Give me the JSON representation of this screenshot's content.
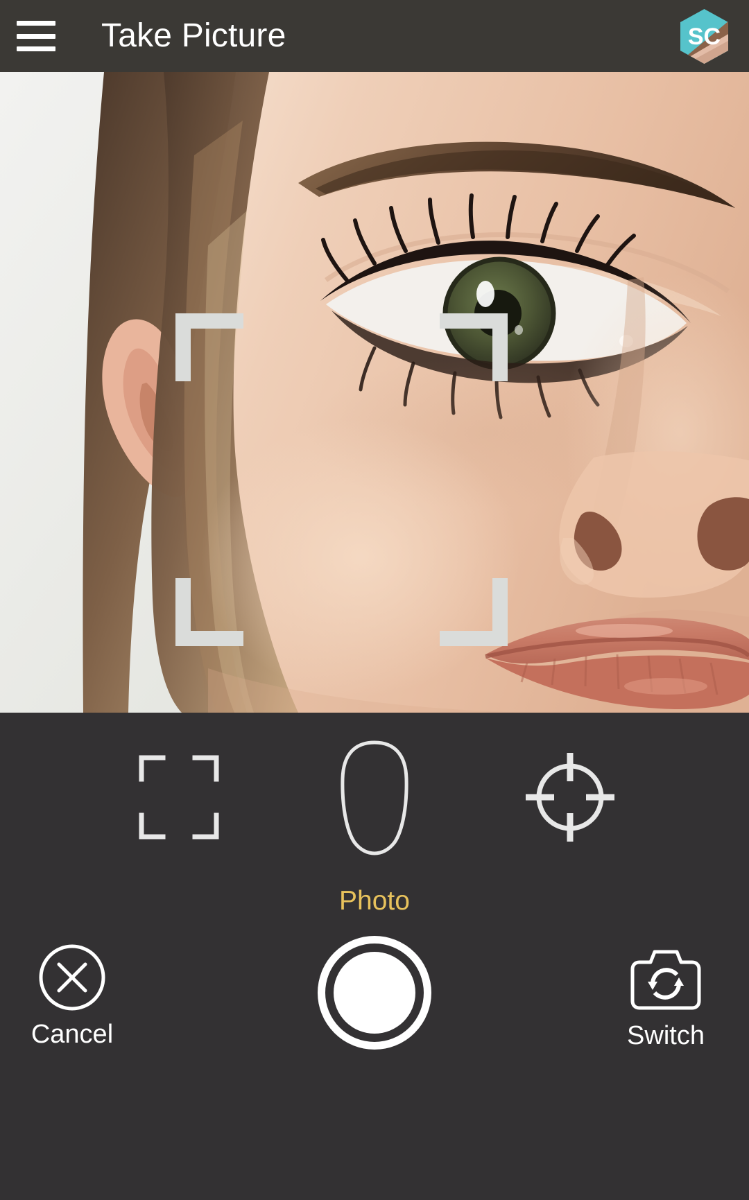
{
  "header": {
    "title": "Take Picture",
    "menu_icon": "hamburger-menu-icon",
    "logo": {
      "icon": "app-logo-hexagon",
      "text": "SC",
      "top_color": "#56C3CB",
      "band_color": "#8B6249",
      "skin_color": "#E3BCA7"
    },
    "background_color": "#3B3935",
    "text_color": "#FFFFFF"
  },
  "preview": {
    "subject": "close-up-female-face",
    "background_color": "#EDEDEB",
    "viewfinder": {
      "icon": "viewfinder-corner-brackets",
      "color": "#DADCDA",
      "corners": [
        "top-left",
        "top-right",
        "bottom-left",
        "bottom-right"
      ]
    }
  },
  "controls": {
    "background_color": "#333133",
    "modes": [
      {
        "id": "frame",
        "icon": "square-frame-brackets-icon",
        "selected": false
      },
      {
        "id": "face",
        "icon": "face-oval-outline-icon",
        "selected": false
      },
      {
        "id": "target",
        "icon": "crosshair-target-icon",
        "selected": false
      }
    ],
    "mode_label": "Photo",
    "mode_label_color": "#E8C25C",
    "actions": {
      "cancel": {
        "label": "Cancel",
        "icon": "close-circle-icon"
      },
      "shutter": {
        "icon": "shutter-button-icon",
        "label": ""
      },
      "switch": {
        "label": "Switch",
        "icon": "camera-switch-icon"
      }
    },
    "icon_color": "#FFFFFF"
  }
}
